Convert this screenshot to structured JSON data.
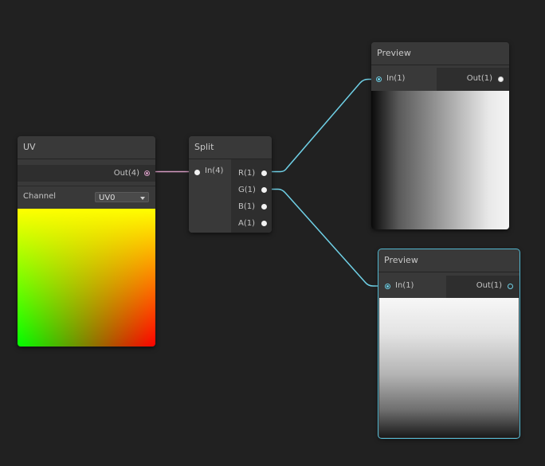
{
  "nodes": {
    "uv": {
      "title": "UV",
      "output_label": "Out(4)",
      "channel_label": "Channel",
      "channel_value": "UV0"
    },
    "split": {
      "title": "Split",
      "input_label": "In(4)",
      "outputs": [
        "R(1)",
        "G(1)",
        "B(1)",
        "A(1)"
      ]
    },
    "preview_1": {
      "title": "Preview",
      "input_label": "In(1)",
      "output_label": "Out(1)"
    },
    "preview_2": {
      "title": "Preview",
      "input_label": "In(1)",
      "output_label": "Out(1)"
    }
  },
  "colors": {
    "background": "#212121",
    "node": "#393939",
    "wire_cyan": "#6fd0e6",
    "wire_pink": "#d49ac1",
    "selection": "#53b8d1"
  }
}
